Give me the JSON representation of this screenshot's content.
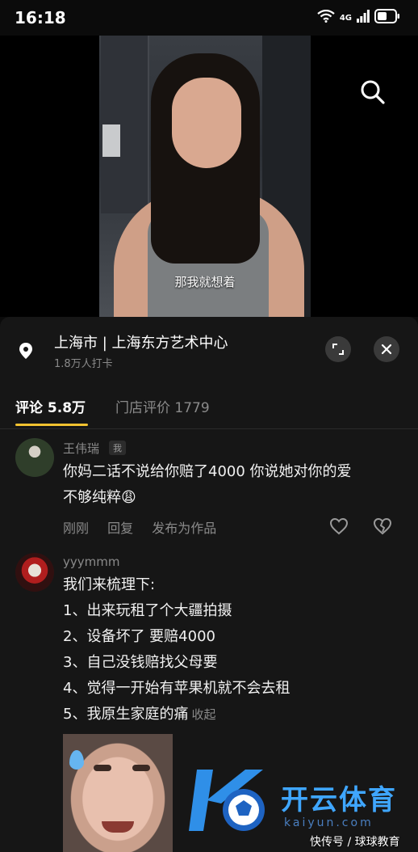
{
  "status_bar": {
    "time": "16:18",
    "network": "4G"
  },
  "video": {
    "caption": "那我就想着"
  },
  "location": {
    "title": "上海市 | 上海东方艺术中心",
    "checkins": "1.8万人打卡"
  },
  "tabs": [
    {
      "label": "评论 5.8万",
      "active": true
    },
    {
      "label": "门店评价 1779",
      "active": false
    }
  ],
  "comments": [
    {
      "username": "王伟瑞",
      "badge": "我",
      "lines": [
        "你妈二话不说给你赔了4000 你说她对你的爱",
        "不够纯粹😩"
      ],
      "actions": [
        "刚刚",
        "回复",
        "发布为作品"
      ]
    },
    {
      "username": "yyymmm",
      "lines": [
        "我们来梳理下:",
        "1、出来玩租了个大疆拍摄",
        "2、设备坏了 要赔4000",
        "3、自己没钱赔找父母要",
        "4、觉得一开始有苹果机就不会去租",
        "5、我原生家庭的痛"
      ],
      "collapse_label": "收起"
    }
  ],
  "watermark": {
    "brand": "开云体育",
    "domain": "kaiyun.com",
    "source": "快传号 / 球球教育"
  },
  "colors": {
    "accent": "#f2c230",
    "panel": "#161616",
    "muted_text": "#8a8a8a",
    "watermark_blue": "#3fa6ff"
  }
}
